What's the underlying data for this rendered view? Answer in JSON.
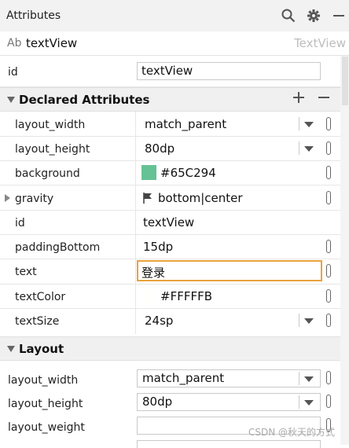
{
  "header": {
    "title": "Attributes"
  },
  "component": {
    "icon_text": "Ab",
    "name": "textView",
    "type": "TextView"
  },
  "top_id": {
    "label": "id",
    "value": "textView"
  },
  "declared": {
    "title": "Declared Attributes",
    "rows": [
      {
        "label": "layout_width",
        "value": "match_parent"
      },
      {
        "label": "layout_height",
        "value": "80dp"
      },
      {
        "label": "background",
        "value": "#65C294",
        "color": "#65C294"
      },
      {
        "label": "gravity",
        "value": "bottom|center"
      },
      {
        "label": "id",
        "value": "textView"
      },
      {
        "label": "paddingBottom",
        "value": "15dp"
      },
      {
        "label": "text",
        "value": "登录"
      },
      {
        "label": "textColor",
        "value": "#FFFFFB",
        "color": "#FFFFFB"
      },
      {
        "label": "textSize",
        "value": "24sp"
      }
    ]
  },
  "layout": {
    "title": "Layout",
    "rows": [
      {
        "label": "layout_width",
        "value": "match_parent"
      },
      {
        "label": "layout_height",
        "value": "80dp"
      },
      {
        "label": "layout_weight",
        "value": ""
      }
    ]
  },
  "watermark": "CSDN @秋天的方式",
  "icons": [
    "search-icon",
    "gear-icon",
    "minus-icon",
    "add-icon",
    "remove-icon",
    "collapse-icon",
    "expand-icon",
    "dropdown-icon",
    "flag-icon",
    "resource-picker-icon"
  ]
}
